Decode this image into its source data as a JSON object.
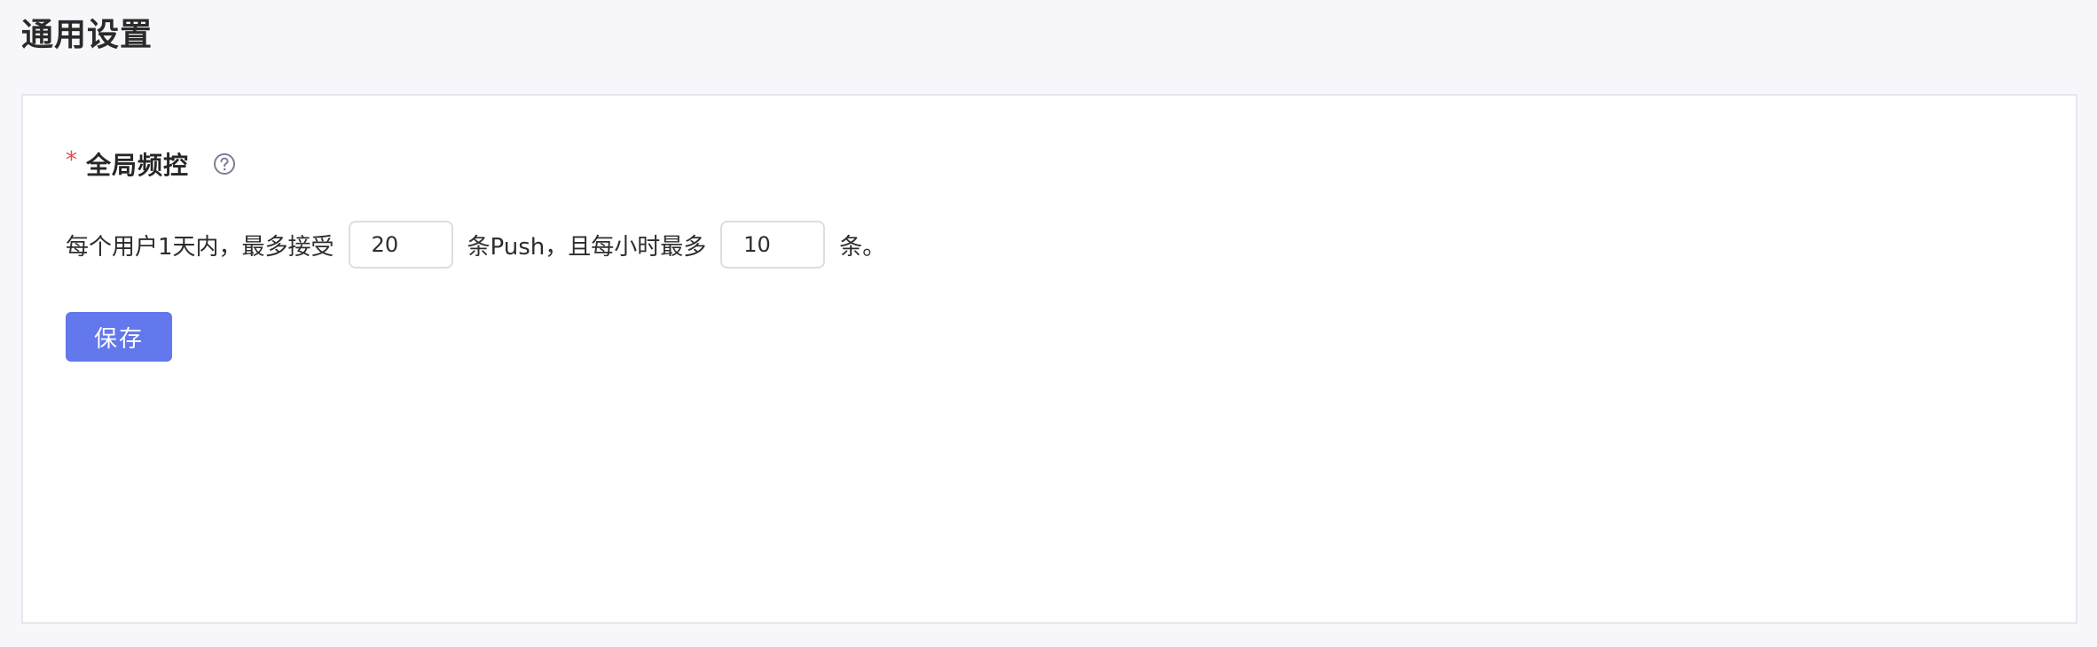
{
  "page": {
    "title": "通用设置"
  },
  "section": {
    "required_mark": "*",
    "title": "全局频控",
    "help_icon": "question-circle-icon"
  },
  "rule": {
    "prefix": "每个用户1天内，最多接受",
    "daily_max": "20",
    "middle": "条Push，且每小时最多",
    "hourly_max": "10",
    "suffix": "条。"
  },
  "actions": {
    "save_label": "保存"
  },
  "colors": {
    "primary": "#6278ec",
    "required": "#e5484d",
    "background": "#f7f7fb",
    "card": "#ffffff"
  }
}
